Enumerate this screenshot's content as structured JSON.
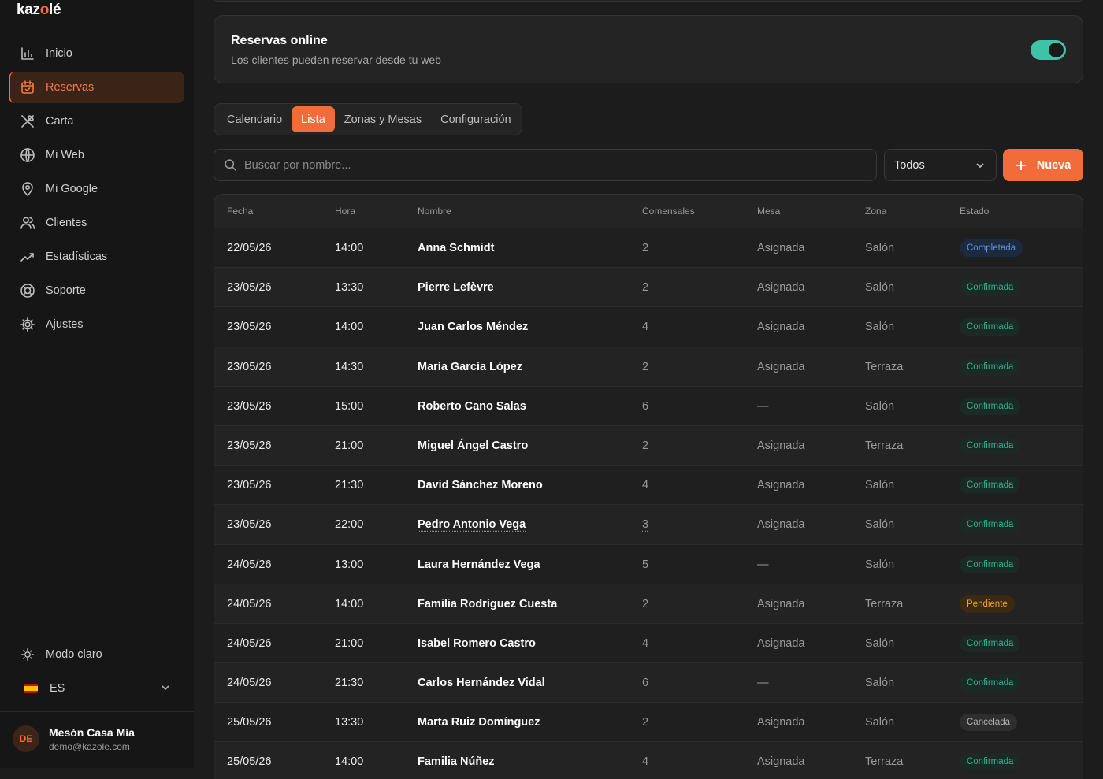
{
  "app": {
    "logo_prefix": "kaz",
    "logo_accent": "o",
    "logo_suffix": "lé"
  },
  "sidebar": {
    "items": [
      {
        "label": "Inicio",
        "icon": "bar-chart-icon"
      },
      {
        "label": "Reservas",
        "icon": "calendar-icon"
      },
      {
        "label": "Carta",
        "icon": "utensils-icon"
      },
      {
        "label": "Mi Web",
        "icon": "globe-icon"
      },
      {
        "label": "Mi Google",
        "icon": "map-pin-icon"
      },
      {
        "label": "Clientes",
        "icon": "users-icon"
      },
      {
        "label": "Estadísticas",
        "icon": "trending-up-icon"
      },
      {
        "label": "Soporte",
        "icon": "lifebuoy-icon"
      },
      {
        "label": "Ajustes",
        "icon": "gear-icon"
      }
    ],
    "active_index": 1,
    "mode_label": "Modo claro",
    "language": "ES",
    "account": {
      "initials": "DE",
      "name": "Mesón Casa Mía",
      "email": "demo@kazole.com"
    }
  },
  "online_card": {
    "title": "Reservas online",
    "subtitle": "Los clientes pueden reservar desde tu web",
    "enabled": true
  },
  "tabs": [
    {
      "label": "Calendario",
      "active": false
    },
    {
      "label": "Lista",
      "active": true
    },
    {
      "label": "Zonas y Mesas",
      "active": false
    },
    {
      "label": "Configuración",
      "active": false
    }
  ],
  "toolbar": {
    "search_placeholder": "Buscar por nombre...",
    "filter_value": "Todos",
    "new_label": "Nueva"
  },
  "table": {
    "headers": [
      "Fecha",
      "Hora",
      "Nombre",
      "Comensales",
      "Mesa",
      "Zona",
      "Estado"
    ],
    "rows": [
      {
        "fecha": "22/05/26",
        "hora": "14:00",
        "nombre": "Anna Schmidt",
        "comensales": "2",
        "mesa": "Asignada",
        "zona": "Salón",
        "estado": "Completada"
      },
      {
        "fecha": "23/05/26",
        "hora": "13:30",
        "nombre": "Pierre Lefèvre",
        "comensales": "2",
        "mesa": "Asignada",
        "zona": "Salón",
        "estado": "Confirmada"
      },
      {
        "fecha": "23/05/26",
        "hora": "14:00",
        "nombre": "Juan Carlos Méndez",
        "comensales": "4",
        "mesa": "Asignada",
        "zona": "Salón",
        "estado": "Confirmada"
      },
      {
        "fecha": "23/05/26",
        "hora": "14:30",
        "nombre": "María García López",
        "comensales": "2",
        "mesa": "Asignada",
        "zona": "Terraza",
        "estado": "Confirmada"
      },
      {
        "fecha": "23/05/26",
        "hora": "15:00",
        "nombre": "Roberto Cano Salas",
        "comensales": "6",
        "mesa": "—",
        "zona": "Salón",
        "estado": "Confirmada"
      },
      {
        "fecha": "23/05/26",
        "hora": "21:00",
        "nombre": "Miguel Ángel Castro",
        "comensales": "2",
        "mesa": "Asignada",
        "zona": "Terraza",
        "estado": "Confirmada"
      },
      {
        "fecha": "23/05/26",
        "hora": "21:30",
        "nombre": "David Sánchez Moreno",
        "comensales": "4",
        "mesa": "Asignada",
        "zona": "Salón",
        "estado": "Confirmada"
      },
      {
        "fecha": "23/05/26",
        "hora": "22:00",
        "nombre": "Pedro Antonio Vega",
        "comensales": "3",
        "mesa": "Asignada",
        "zona": "Salón",
        "estado": "Confirmada"
      },
      {
        "fecha": "24/05/26",
        "hora": "13:00",
        "nombre": "Laura Hernández Vega",
        "comensales": "5",
        "mesa": "—",
        "zona": "Salón",
        "estado": "Confirmada"
      },
      {
        "fecha": "24/05/26",
        "hora": "14:00",
        "nombre": "Familia Rodríguez Cuesta",
        "comensales": "2",
        "mesa": "Asignada",
        "zona": "Terraza",
        "estado": "Pendiente"
      },
      {
        "fecha": "24/05/26",
        "hora": "21:00",
        "nombre": "Isabel Romero Castro",
        "comensales": "4",
        "mesa": "Asignada",
        "zona": "Salón",
        "estado": "Confirmada"
      },
      {
        "fecha": "24/05/26",
        "hora": "21:30",
        "nombre": "Carlos Hernández Vidal",
        "comensales": "6",
        "mesa": "—",
        "zona": "Salón",
        "estado": "Confirmada"
      },
      {
        "fecha": "25/05/26",
        "hora": "13:30",
        "nombre": "Marta Ruiz Domínguez",
        "comensales": "2",
        "mesa": "Asignada",
        "zona": "Salón",
        "estado": "Cancelada"
      },
      {
        "fecha": "25/05/26",
        "hora": "14:00",
        "nombre": "Familia Núñez",
        "comensales": "4",
        "mesa": "Asignada",
        "zona": "Terraza",
        "estado": "Confirmada"
      }
    ]
  },
  "colors": {
    "accent": "#f26b3a",
    "toggle_on": "#3cc3a8",
    "completada": "#5b93e0",
    "confirmada": "#2fb08c",
    "pendiente": "#e8a43a",
    "cancelada": "#b5b5b5"
  }
}
